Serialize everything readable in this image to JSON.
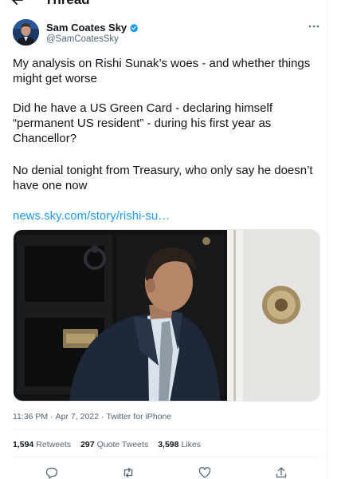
{
  "header": {
    "title": "Thread"
  },
  "tweet": {
    "author": {
      "display_name": "Sam Coates Sky",
      "handle": "@SamCoatesSky",
      "verified": true
    },
    "text": {
      "p1": "My analysis on Rishi Sunak’s woes - and whether things might get worse",
      "p2": "Did he have a US Green Card - declaring himself “permanent US resident” - during his first year as Chancellor?",
      "p3": "No denial tonight from Treasury, who only say he doesn’t have one now",
      "link": "news.sky.com/story/rishi-su…"
    },
    "meta": {
      "time": "11:36 PM",
      "separator1": "·",
      "date": "Apr 7, 2022",
      "separator2": "·",
      "source": "Twitter for iPhone"
    },
    "stats": {
      "retweets_count": "1,594",
      "retweets_label": "Retweets",
      "quotes_count": "297",
      "quotes_label": "Quote Tweets",
      "likes_count": "3,598",
      "likes_label": "Likes"
    }
  },
  "colors": {
    "accent": "#1d9bf0",
    "text_primary": "#0f1419",
    "text_secondary": "#536471",
    "divider": "#eff3f4"
  },
  "icons": {
    "back": "arrow-left-icon",
    "verified": "verified-badge-icon",
    "more": "more-horizontal-icon",
    "reply": "reply-icon",
    "retweet": "retweet-icon",
    "like": "heart-icon",
    "share": "share-icon"
  }
}
